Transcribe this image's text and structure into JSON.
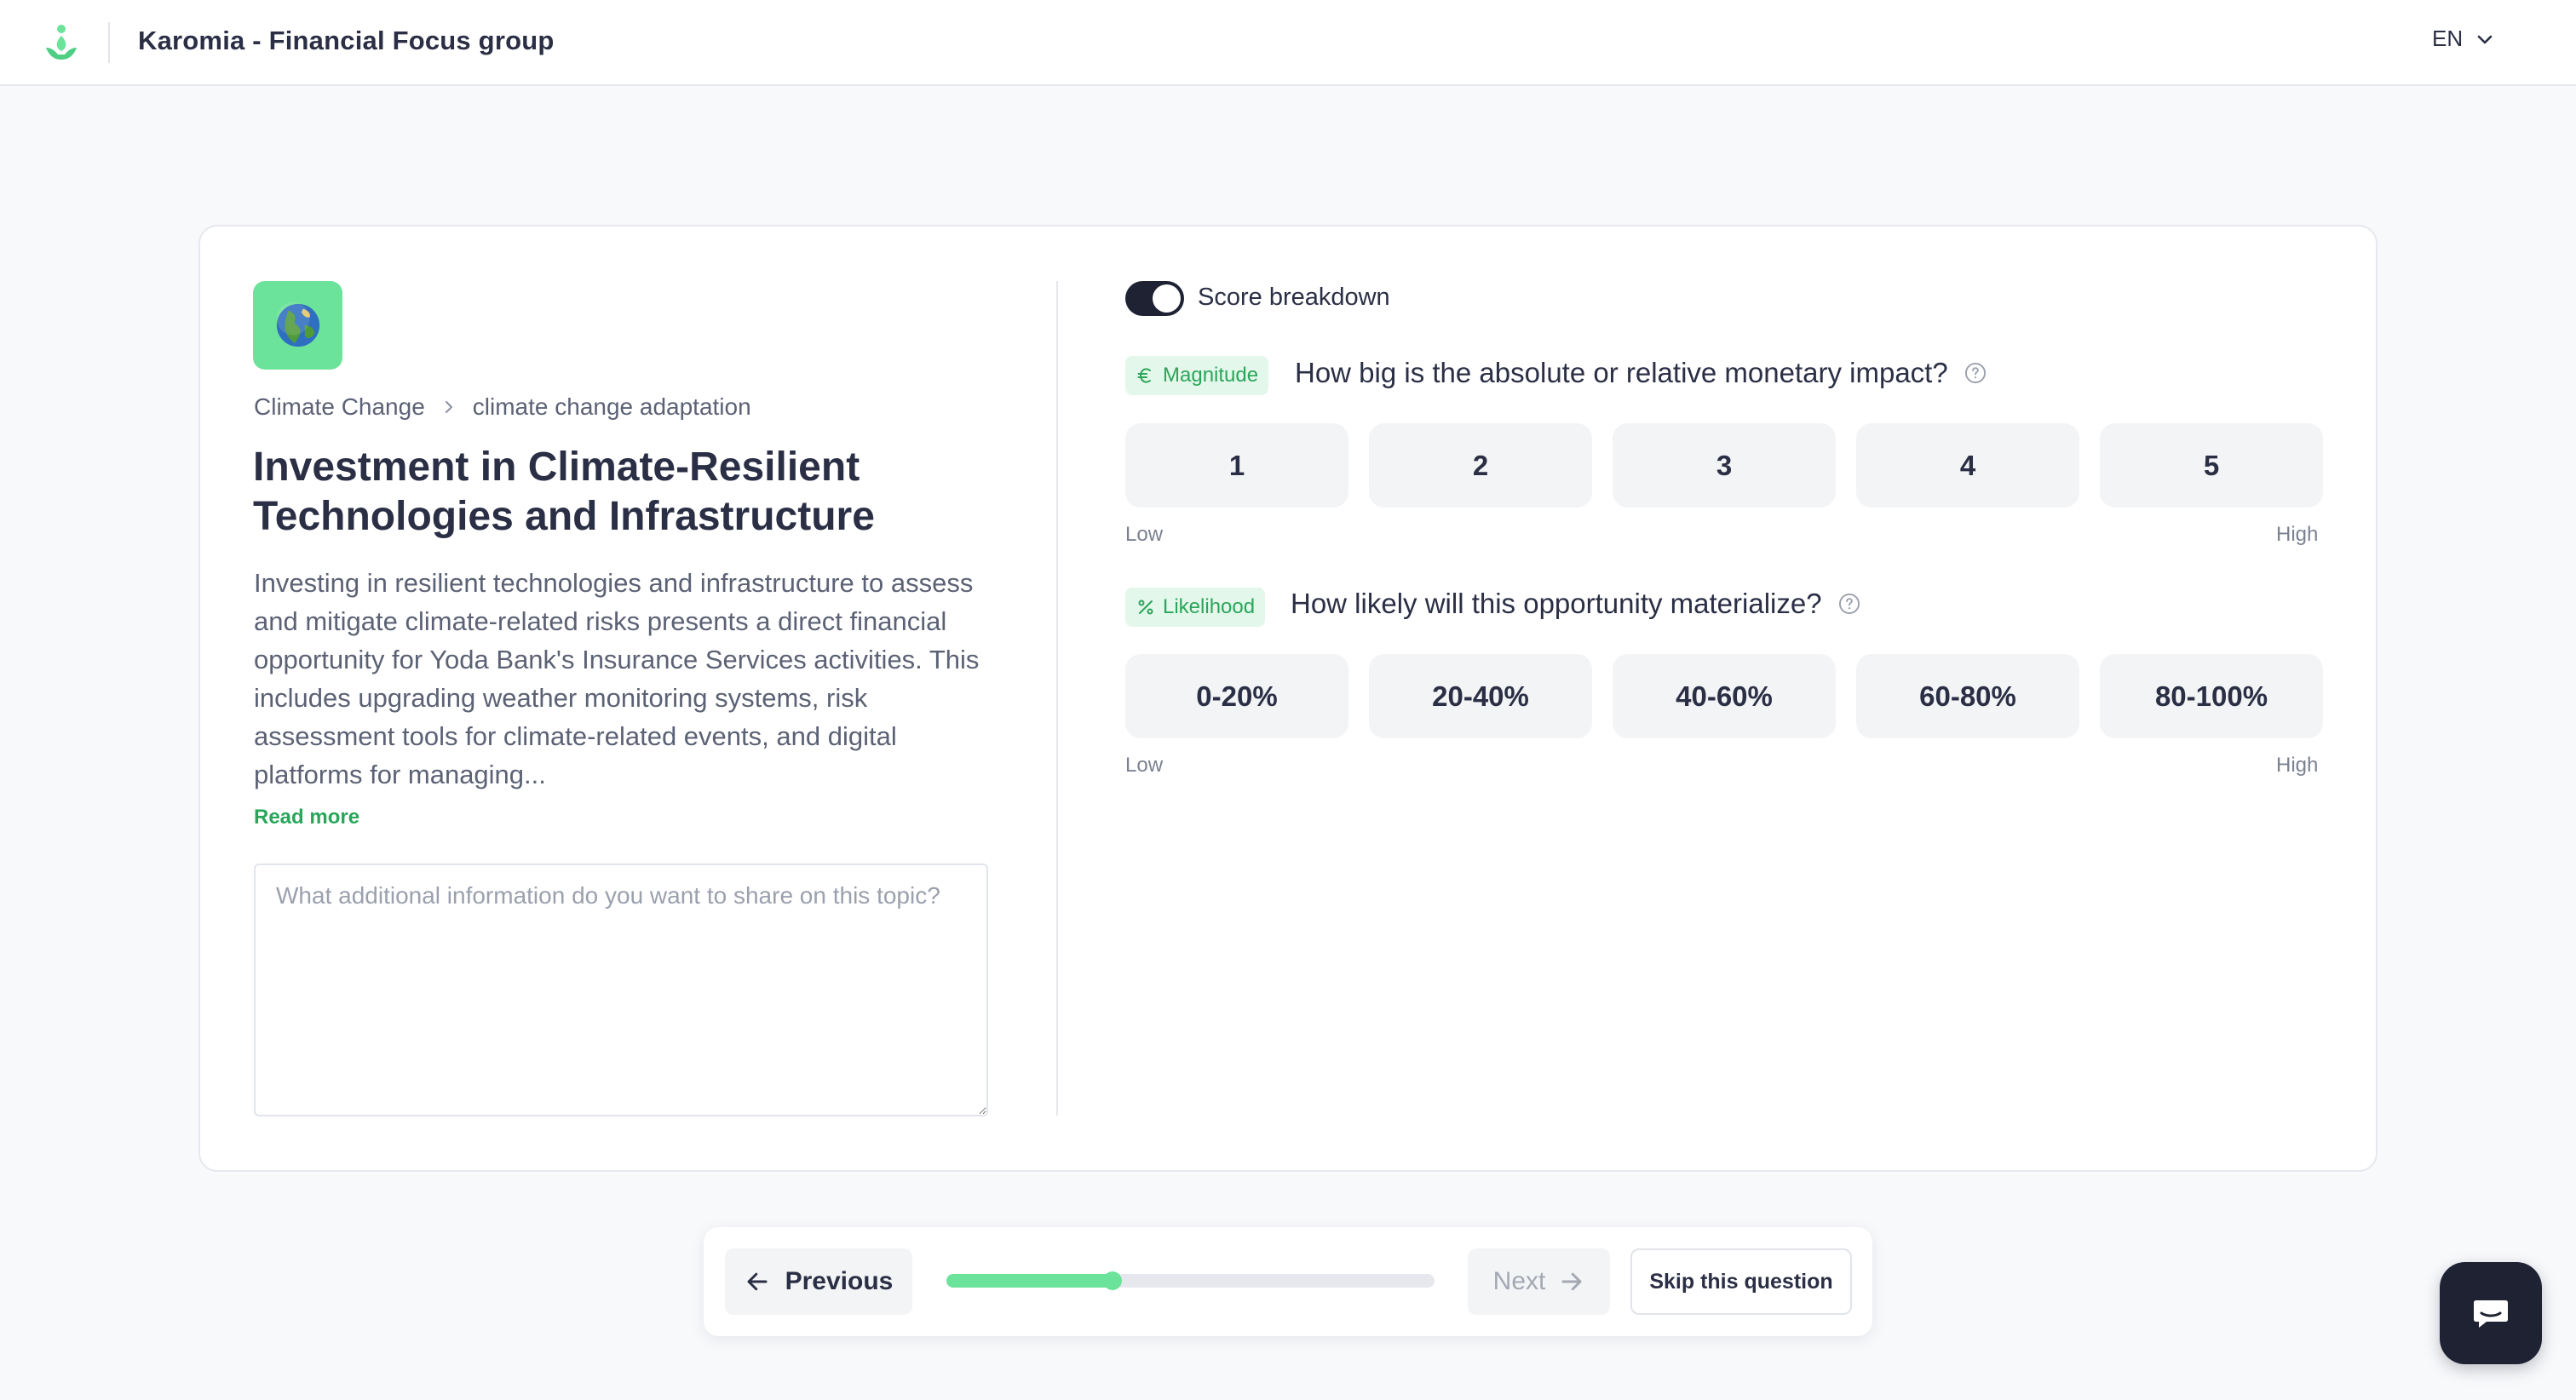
{
  "header": {
    "title": "Karomia - Financial Focus group",
    "language": "EN"
  },
  "topic": {
    "breadcrumb": [
      "Climate Change",
      "climate change adaptation"
    ],
    "title": "Investment in Climate-Resilient Technologies and Infrastructure",
    "description": "Investing in resilient technologies and infrastructure to assess and mitigate climate-related risks presents a direct financial opportunity for Yoda Bank's Insurance Services activities. This includes upgrading weather monitoring systems, risk assessment tools for climate-related events, and digital platforms for managing...",
    "read_more": "Read more",
    "notes_placeholder": "What additional information do you want to share on this topic?"
  },
  "scoring": {
    "toggle_label": "Score breakdown",
    "toggle_on": true,
    "magnitude": {
      "tag": "Magnitude",
      "question": "How big is the absolute or relative monetary impact?",
      "options": [
        "1",
        "2",
        "3",
        "4",
        "5"
      ],
      "low": "Low",
      "high": "High"
    },
    "likelihood": {
      "tag": "Likelihood",
      "question": "How likely will this opportunity materialize?",
      "options": [
        "0-20%",
        "20-40%",
        "40-60%",
        "60-80%",
        "80-100%"
      ],
      "low": "Low",
      "high": "High"
    }
  },
  "nav": {
    "previous": "Previous",
    "next": "Next",
    "skip": "Skip this question",
    "progress_fraction": 0.34
  },
  "colors": {
    "accent": "#6ce39a",
    "accent_text": "#2aa65b",
    "dark": "#1e2233"
  }
}
